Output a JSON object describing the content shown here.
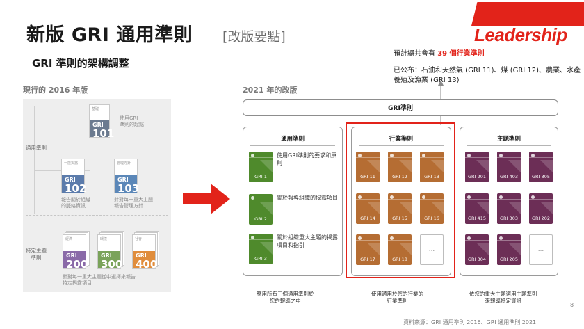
{
  "header": {
    "title": "新版 GRI 通用準則",
    "title_tag": "[改版要點]",
    "subtitle": "GRI 準則的架構調整",
    "brand": "Leadership",
    "brand_color": "#e2231a"
  },
  "old_version": {
    "label": "現行的 2016 年版",
    "side_universal": "通用準則",
    "side_topic": "特定主題\n準則",
    "cards": [
      {
        "tag": "基礎",
        "prefix": "GRI",
        "number": "101",
        "desc": "使用GRI\n準則的起點",
        "color": "#6b7a8f"
      },
      {
        "tag": "一般揭露",
        "prefix": "GRI",
        "number": "102",
        "desc": "報告關於組織\n的脈絡資訊",
        "color": "#5b7bab"
      },
      {
        "tag": "管理方針",
        "prefix": "GRI",
        "number": "103",
        "desc": "針對每一重大主題\n報告管理方針",
        "color": "#5b87b8"
      },
      {
        "tag": "經濟",
        "prefix": "GRI",
        "number": "200",
        "color": "#8a6aa8"
      },
      {
        "tag": "環境",
        "prefix": "GRI",
        "number": "300",
        "color": "#7aa35a"
      },
      {
        "tag": "社會",
        "prefix": "GRI",
        "number": "400",
        "color": "#e08d3c"
      }
    ],
    "topic_desc": "針對每一重大主題從中選擇來報告\n特定揭露項目"
  },
  "new_version": {
    "label": "2021 年的改版",
    "top_bar": "GRI準則",
    "columns": [
      {
        "heading": "通用準則",
        "books": [
          "GRI 1",
          "GRI 2",
          "GRI 3"
        ],
        "descs": [
          "使用GRI準則的要求和原則",
          "關於報導組織的揭露項目",
          "關於組織重大主題的揭露項目和指引"
        ],
        "caption": "應用所有三個通用準則於\n您的報導之中"
      },
      {
        "heading": "行業準則",
        "books": [
          "GRI 11",
          "GRI 12",
          "GRI 13",
          "GRI 14",
          "GRI 15",
          "GRI 16",
          "GRI 17",
          "GRI 18"
        ],
        "more": "...",
        "caption": "使用適用於您的行業的\n行業準則"
      },
      {
        "heading": "主題準則",
        "books": [
          "GRI 201",
          "GRI 403",
          "GRI 305",
          "GRI 415",
          "GRI 303",
          "GRI 202",
          "GRI 304",
          "GRI 205"
        ],
        "more": "...",
        "caption": "依您的重大主題選用主題準則\n來報導特定資訊"
      }
    ],
    "colors": {
      "universal": "#4f8a2c",
      "industry": "#b56d33",
      "topic": "#6c2e56",
      "highlight": "#e2231a"
    }
  },
  "notes": {
    "line1_prefix": "預計總共會有",
    "line1_count": "39 個行業準則",
    "line2": "已公布：石油和天然氣 (GRI 11)、煤 (GRI 12)、農業、水產養殖及漁業 (GRI 13)"
  },
  "footer": {
    "source": "資料來源：GRI 通用準則 2016、GRI 通用準則 2021",
    "page": "8"
  }
}
